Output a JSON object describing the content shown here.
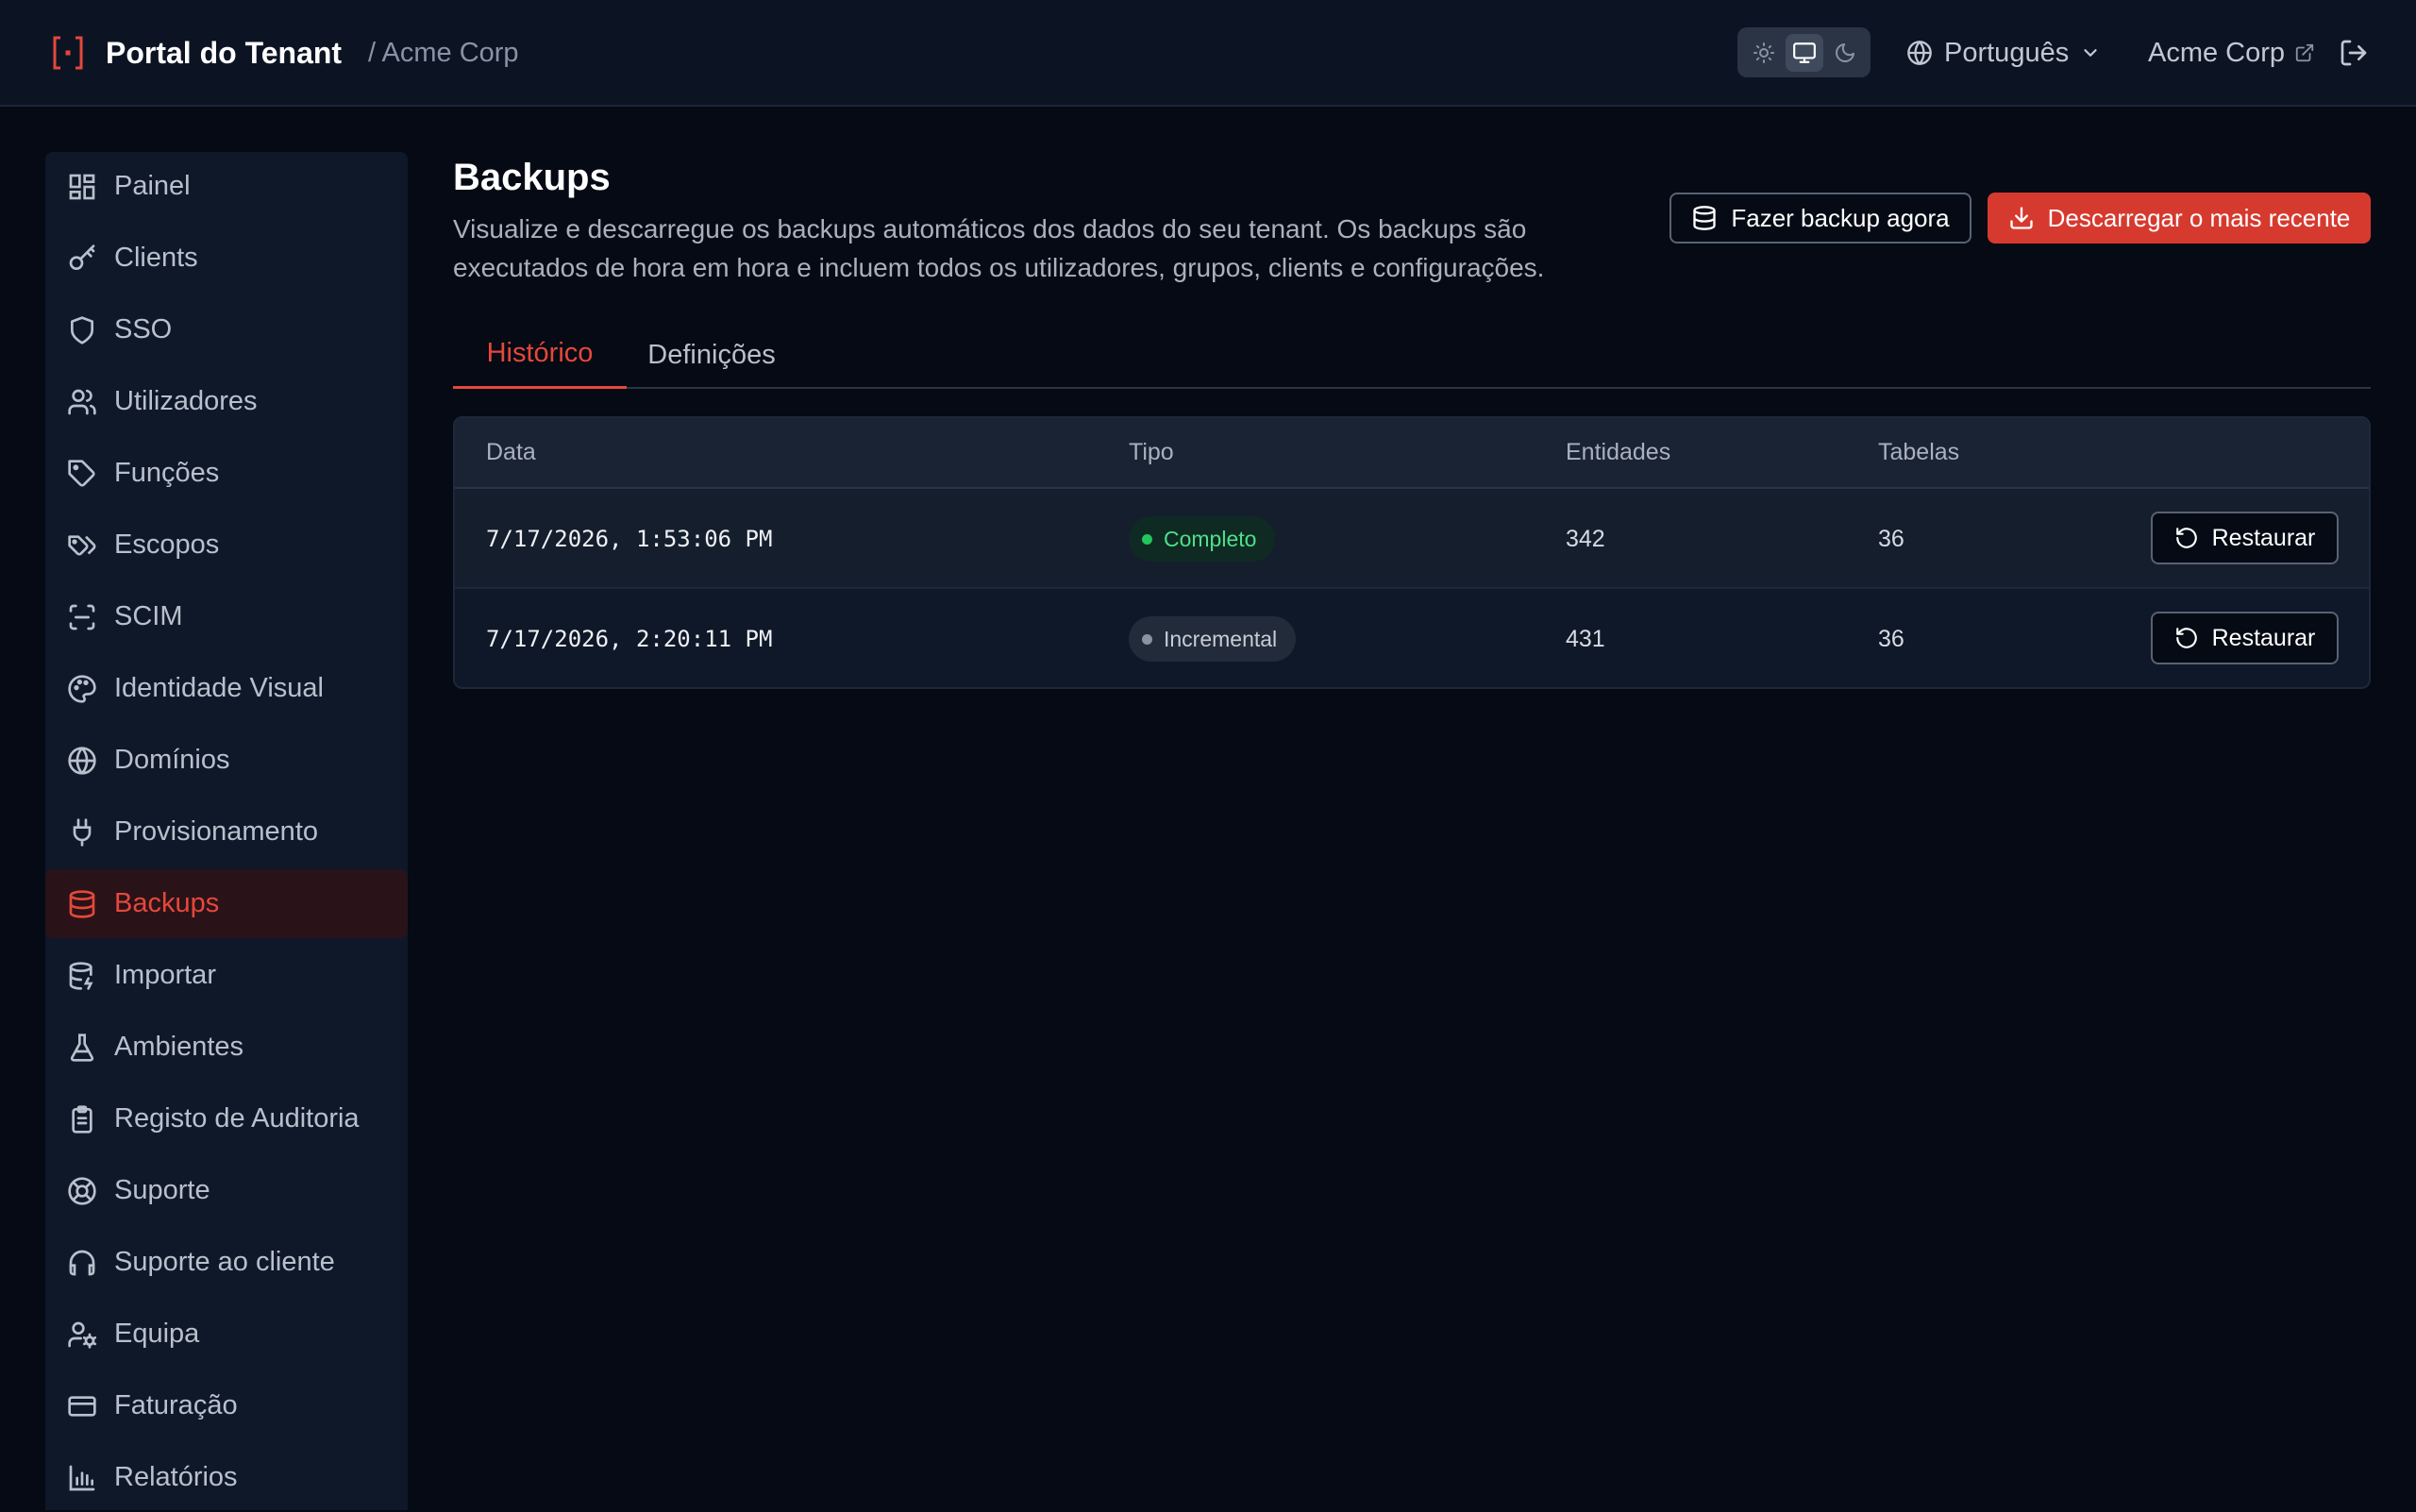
{
  "header": {
    "title": "Portal do Tenant",
    "breadcrumb": "/ Acme Corp",
    "theme_options": [
      "light-icon",
      "monitor-icon",
      "moon-icon"
    ],
    "theme_selected": "monitor-icon",
    "language": "Português",
    "tenant_link": "Acme Corp"
  },
  "sidebar": {
    "items": [
      {
        "label": "Painel",
        "icon": "dashboard-icon"
      },
      {
        "label": "Clients",
        "icon": "key-icon"
      },
      {
        "label": "SSO",
        "icon": "shield-icon"
      },
      {
        "label": "Utilizadores",
        "icon": "users-icon"
      },
      {
        "label": "Funções",
        "icon": "tag-icon"
      },
      {
        "label": "Escopos",
        "icon": "tags-icon"
      },
      {
        "label": "SCIM",
        "icon": "scan-icon"
      },
      {
        "label": "Identidade Visual",
        "icon": "palette-icon"
      },
      {
        "label": "Domínios",
        "icon": "globe-icon"
      },
      {
        "label": "Provisionamento",
        "icon": "plug-icon"
      },
      {
        "label": "Backups",
        "icon": "database-icon",
        "active": true
      },
      {
        "label": "Importar",
        "icon": "database-import-icon"
      },
      {
        "label": "Ambientes",
        "icon": "flask-icon"
      },
      {
        "label": "Registo de Auditoria",
        "icon": "clipboard-icon"
      },
      {
        "label": "Suporte",
        "icon": "life-buoy-icon"
      },
      {
        "label": "Suporte ao cliente",
        "icon": "headphones-icon"
      },
      {
        "label": "Equipa",
        "icon": "user-cog-icon"
      },
      {
        "label": "Faturação",
        "icon": "credit-card-icon"
      },
      {
        "label": "Relatórios",
        "icon": "bar-chart-icon"
      }
    ]
  },
  "main": {
    "title": "Backups",
    "description": "Visualize e descarregue os backups automáticos dos dados do seu tenant. Os backups são executados de hora em hora e incluem todos os utilizadores, grupos, clients e configurações.",
    "backup_now_label": "Fazer backup agora",
    "download_latest_label": "Descarregar o mais recente",
    "tabs": [
      {
        "label": "Histórico",
        "active": true
      },
      {
        "label": "Definições",
        "active": false
      }
    ],
    "table": {
      "columns": [
        "Data",
        "Tipo",
        "Entidades",
        "Tabelas"
      ],
      "rows": [
        {
          "date": "7/17/2026, 1:53:06 PM",
          "type": "Completo",
          "entities": "342",
          "tables": "36",
          "action": "Restaurar"
        },
        {
          "date": "7/17/2026, 2:20:11 PM",
          "type": "Incremental",
          "entities": "431",
          "tables": "36",
          "action": "Restaurar"
        }
      ]
    }
  },
  "colors": {
    "accent": "#e5483a",
    "primary_button": "#d63a2f",
    "success": "#22c55e",
    "background": "#050a14",
    "sidebar": "#0f1829"
  }
}
